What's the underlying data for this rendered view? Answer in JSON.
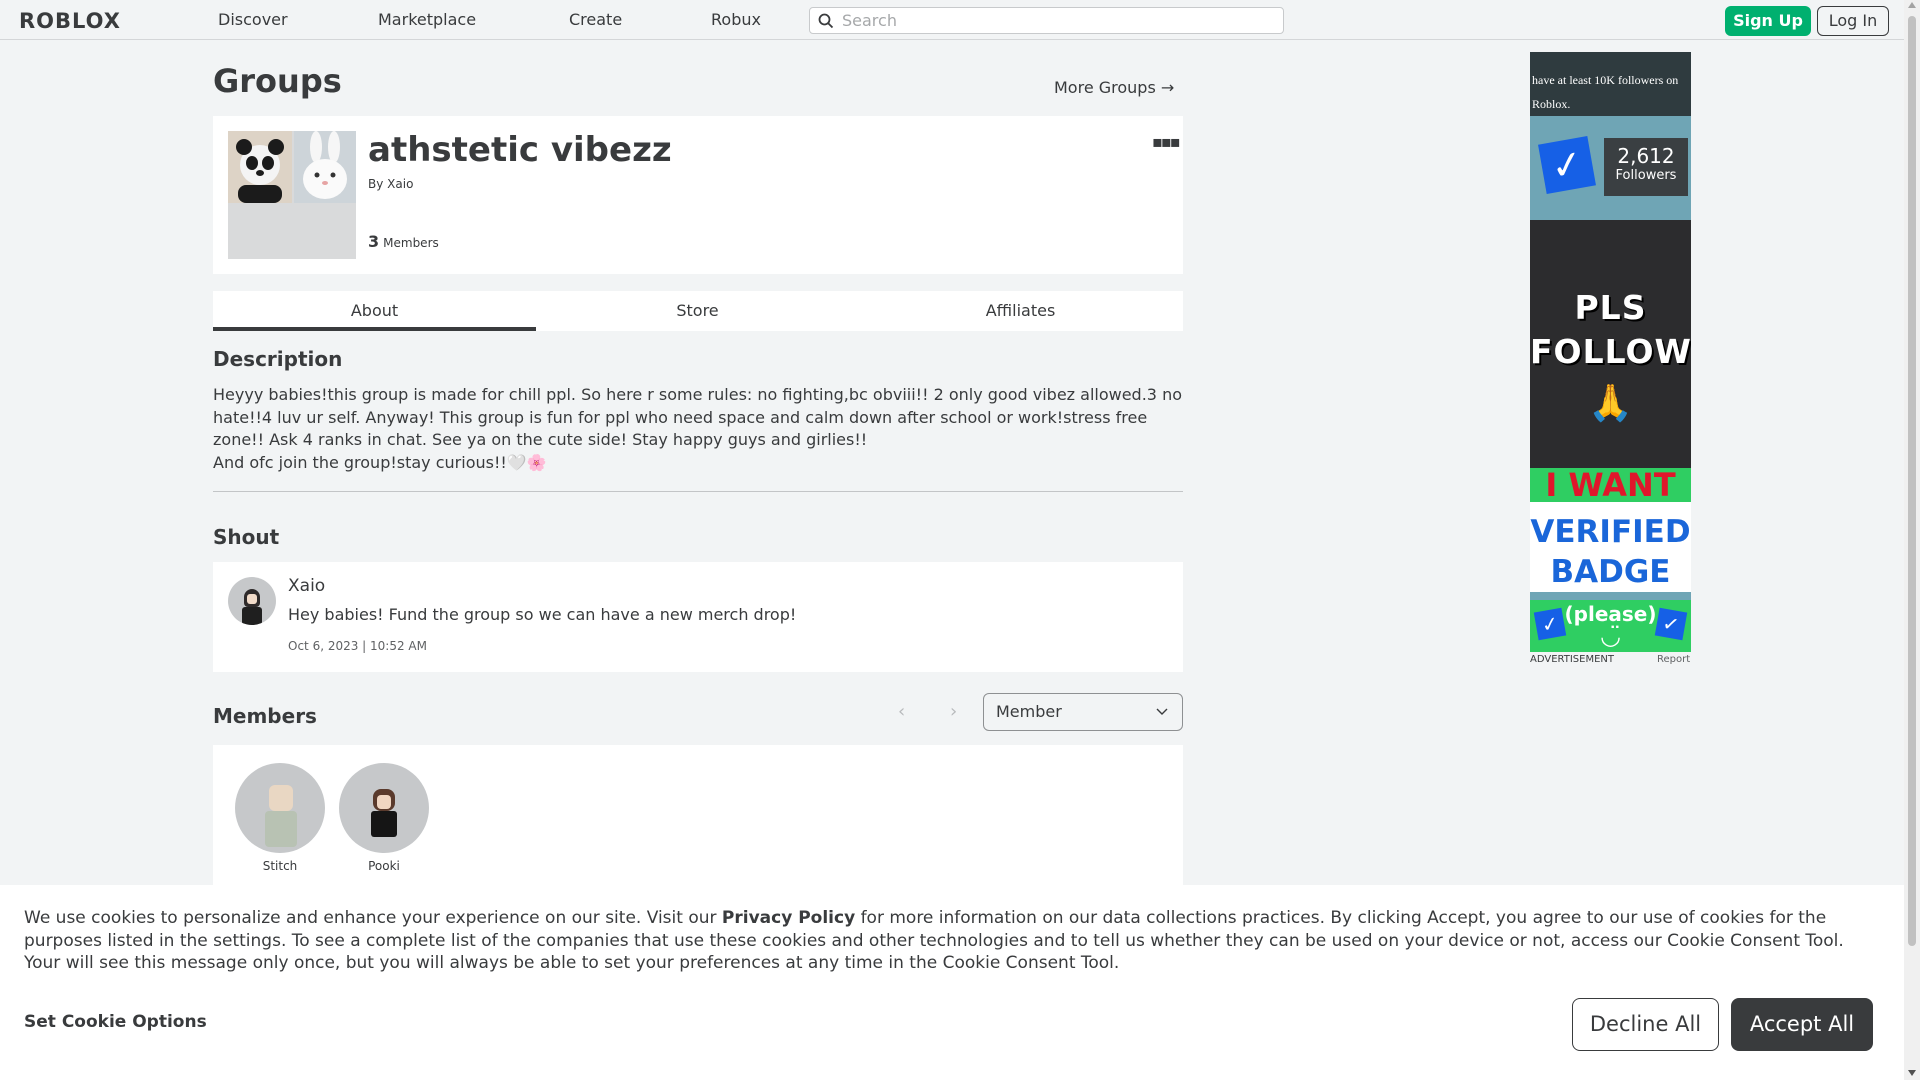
{
  "nav": {
    "logo": "ROBLOX",
    "links": [
      "Discover",
      "Marketplace",
      "Create",
      "Robux"
    ],
    "search_placeholder": "Search",
    "signup": "Sign Up",
    "login": "Log In"
  },
  "page": {
    "title": "Groups",
    "more_groups": "More Groups →"
  },
  "group": {
    "name": "athstetic vibezz",
    "by_label": "By",
    "owner": "Xaio",
    "member_count": "3",
    "members_label": "Members",
    "more_icon": "ellipsis-icon"
  },
  "tabs": [
    "About",
    "Store",
    "Affiliates"
  ],
  "active_tab": "About",
  "description": {
    "heading": "Description",
    "text": "Heyyy babies!this group is made for chill ppl. So here r some rules: no fighting,bc obviii!! 2 only good vibez allowed.3 no hate!!4 luv ur self. Anyway! This group is fun for ppl who need space and calm down after school or work!stress free zone!! Ask 4 ranks in chat. See ya on the cute side! Stay happy guys and girlies!!",
    "text2": "And ofc join the group!stay curious!!🤍🌸"
  },
  "shout": {
    "heading": "Shout",
    "user": "Xaio",
    "body": "Hey babies! Fund the group so we can have a new merch drop!",
    "date": "Oct 6, 2023 | 10:52 AM"
  },
  "members": {
    "heading": "Members",
    "role_select": "Member",
    "list": [
      {
        "name": "Stitch"
      },
      {
        "name": "Pooki"
      }
    ]
  },
  "ad": {
    "top_text": "have at least 10K followers on Roblox.",
    "followers_number": "2,612",
    "followers_label": "Followers",
    "line1": "PLS",
    "line2": "FOLLOW",
    "line3": "I WANT",
    "line4": "VERIFIED",
    "line5": "BADGE",
    "line6": "(please)",
    "label": "ADVERTISEMENT",
    "report": "Report"
  },
  "cookie": {
    "text_before": "We use cookies to personalize and enhance your experience on our site. Visit our ",
    "privacy_link": "Privacy Policy",
    "text_after": " for more information on our data collections practices. By clicking Accept, you agree to our use of cookies for the purposes listed in the settings. To see a complete list of the companies that use these cookies and other technologies and to tell us whether they can be used on your device or not, access our Cookie Consent Tool. Your will see this message only once, but you will always be able to set your preferences at any time in the Cookie Consent Tool.",
    "options": "Set Cookie Options",
    "decline": "Decline All",
    "accept": "Accept All"
  },
  "colors": {
    "signup_green": "#00b06f",
    "page_bg": "#f2f4f5",
    "text": "#393b3d"
  }
}
